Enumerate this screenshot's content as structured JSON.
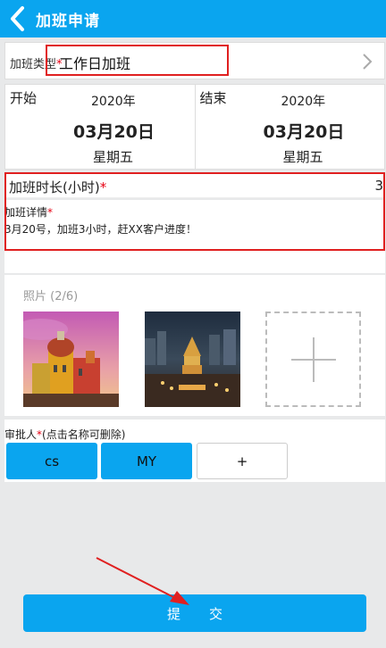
{
  "header": {
    "title": "加班申请",
    "back_icon": "back-chevron-icon"
  },
  "overtime_type": {
    "label": "加班类型",
    "required_mark": "*",
    "value": "工作日加班"
  },
  "start": {
    "label": "开始",
    "year": "2020年",
    "month_day": "03月20日",
    "weekday": "星期五"
  },
  "end": {
    "label": "结束",
    "year": "2020年",
    "month_day": "03月20日",
    "weekday": "星期五"
  },
  "duration": {
    "label": "加班时长(小时)",
    "required_mark": "*",
    "value": "3"
  },
  "detail": {
    "label": "加班详情",
    "required_mark": "*",
    "text": "3月20号，加班3小时，赶XX客户进度！"
  },
  "photos": {
    "label": "照片 (2/6)"
  },
  "approvers": {
    "label": "审批人",
    "required_mark": "*",
    "hint": "(点击名称可删除)",
    "items": [
      "cs",
      "MY"
    ],
    "add_label": "+"
  },
  "submit": {
    "label": "提交"
  },
  "colors": {
    "accent": "#0aa5ef",
    "annotation_red": "#e02020",
    "required_red": "#e60012"
  }
}
